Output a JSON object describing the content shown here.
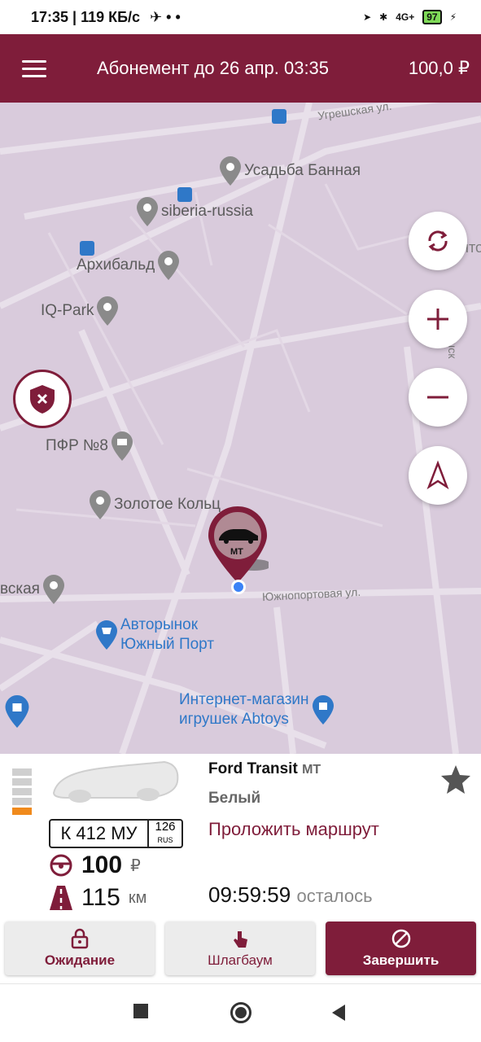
{
  "status_bar": {
    "time_net": "17:35 | 119 КБ/с",
    "battery": "97",
    "net": "4G+"
  },
  "app_bar": {
    "title": "Абонемент до 26 апр. 03:35",
    "balance": "100,0 ₽"
  },
  "map": {
    "pois": [
      {
        "label": "Усадьба Банная",
        "kind": "gray"
      },
      {
        "label": "siberia-russia",
        "kind": "gray"
      },
      {
        "label": "Архибальд",
        "kind": "gray"
      },
      {
        "label": "IQ-Park",
        "kind": "gray"
      },
      {
        "label": "ПФР №8",
        "kind": "gray"
      },
      {
        "label": "Золотое Кольц",
        "kind": "gray"
      },
      {
        "label": "вская",
        "kind": "gray"
      },
      {
        "label": "Авторынок\nЮжный Порт",
        "kind": "blue"
      },
      {
        "label": "Интернет-магазин\nигрушек Abtoys",
        "kind": "blue"
      }
    ],
    "streets": [
      "Угрешская ул.",
      "Южнопортовая ул.",
      "шск",
      "нто"
    ],
    "marker_label": "МТ"
  },
  "car": {
    "model": "Ford Transit",
    "model_tag": "МТ",
    "color": "Белый",
    "route_link": "Проложить маршрут",
    "plate_number": "К 412 МУ",
    "plate_region": "126",
    "plate_country": "RUS",
    "price": "100",
    "price_unit": "₽",
    "range": "115",
    "range_unit": "км",
    "timer": "09:59:59",
    "timer_label": "осталось",
    "fuel_level": 0.2
  },
  "actions": {
    "wait": "Ожидание",
    "barrier": "Шлагбаум",
    "finish": "Завершить"
  },
  "colors": {
    "brand": "#7f1d3a",
    "map": "#d9cbdc",
    "fuel": "#f08a1c"
  }
}
